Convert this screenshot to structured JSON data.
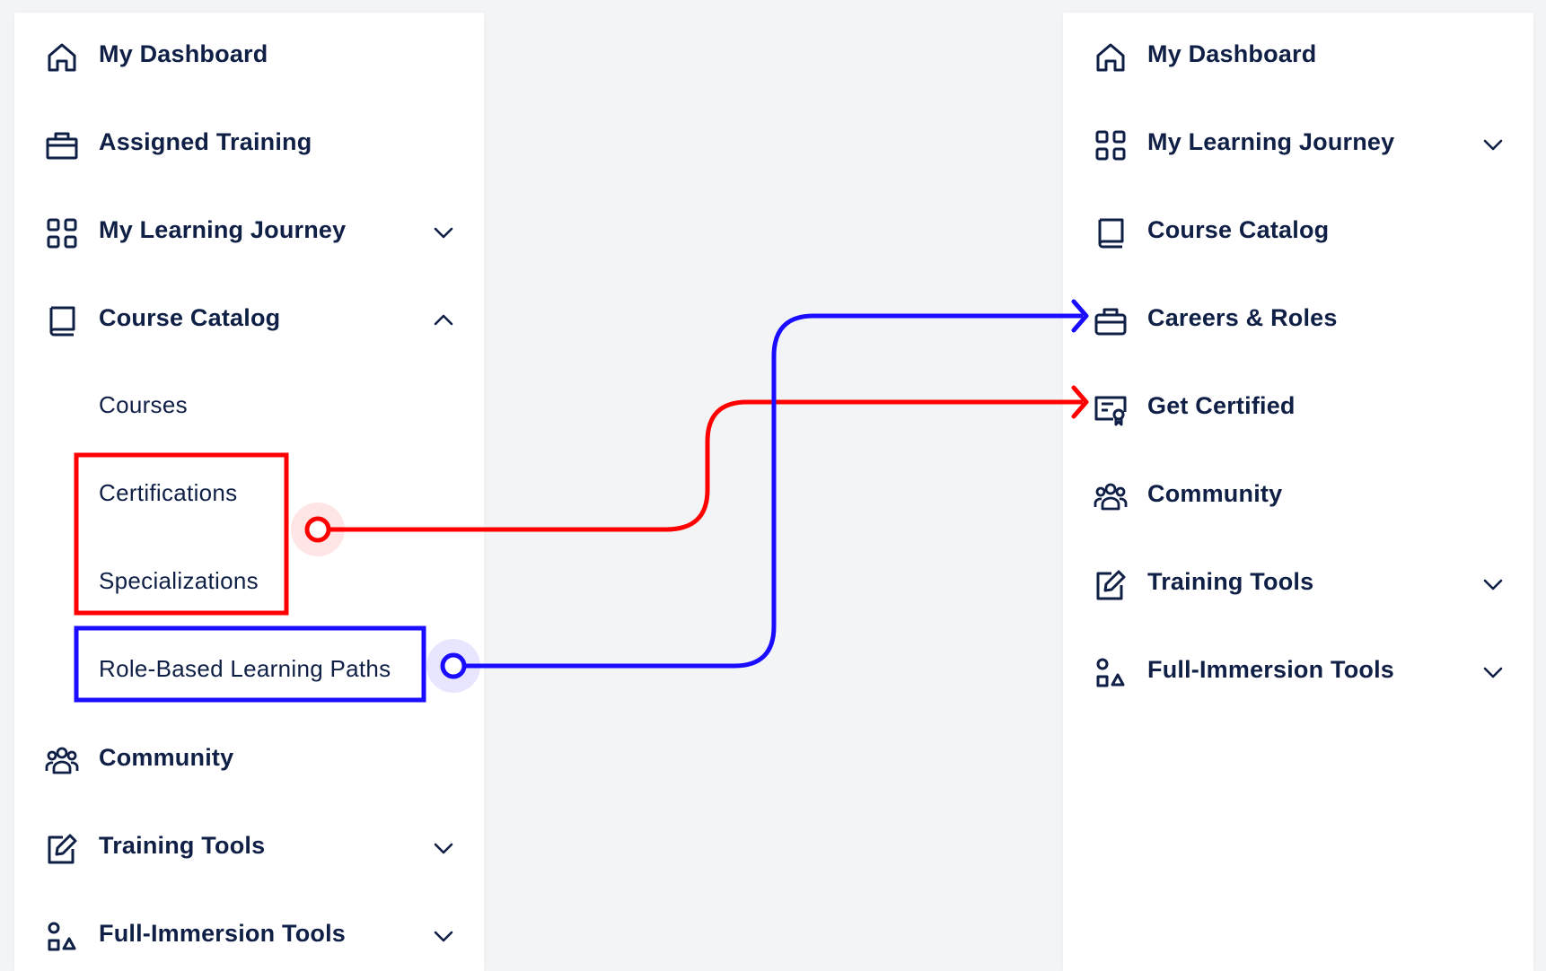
{
  "colors": {
    "background": "#f3f4f6",
    "panel": "#ffffff",
    "text": "#0f1f45",
    "highlight_red": "#ff0000",
    "highlight_blue": "#1a0dff"
  },
  "left_nav": {
    "items": [
      {
        "label": "My Dashboard",
        "icon": "home-icon"
      },
      {
        "label": "Assigned Training",
        "icon": "briefcase-icon"
      },
      {
        "label": "My Learning Journey",
        "icon": "grid-icon",
        "chevron": "down"
      },
      {
        "label": "Course Catalog",
        "icon": "book-icon",
        "chevron": "up"
      },
      {
        "label": "Community",
        "icon": "people-icon"
      },
      {
        "label": "Training Tools",
        "icon": "edit-icon",
        "chevron": "down"
      },
      {
        "label": "Full-Immersion Tools",
        "icon": "shapes-icon",
        "chevron": "down"
      }
    ],
    "course_catalog_subitems": [
      {
        "label": "Courses"
      },
      {
        "label": "Certifications"
      },
      {
        "label": "Specializations"
      },
      {
        "label": "Role-Based Learning Paths"
      }
    ]
  },
  "right_nav": {
    "items": [
      {
        "label": "My Dashboard",
        "icon": "home-icon"
      },
      {
        "label": "My Learning Journey",
        "icon": "grid-icon",
        "chevron": "down"
      },
      {
        "label": "Course Catalog",
        "icon": "book-icon"
      },
      {
        "label": "Careers & Roles",
        "icon": "briefcase-icon"
      },
      {
        "label": "Get Certified",
        "icon": "certificate-icon"
      },
      {
        "label": "Community",
        "icon": "people-icon"
      },
      {
        "label": "Training Tools",
        "icon": "edit-icon",
        "chevron": "down"
      },
      {
        "label": "Full-Immersion Tools",
        "icon": "shapes-icon",
        "chevron": "down"
      }
    ]
  }
}
